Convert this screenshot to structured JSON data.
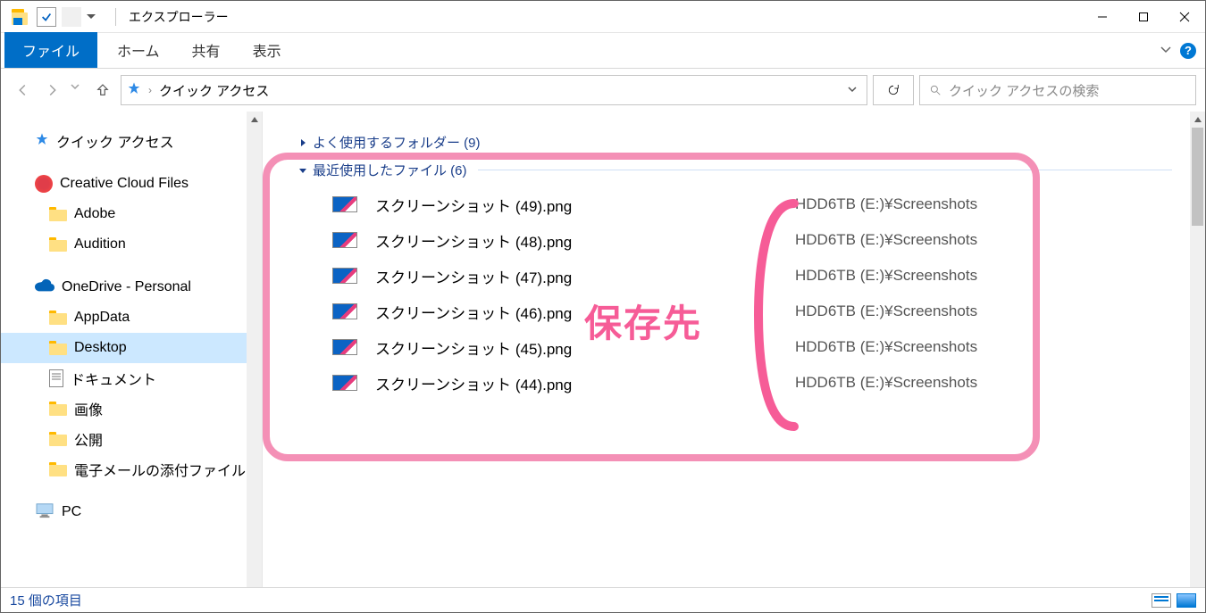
{
  "title": "エクスプローラー",
  "tabs": {
    "file": "ファイル",
    "home": "ホーム",
    "share": "共有",
    "view": "表示"
  },
  "address": {
    "location": "クイック アクセス"
  },
  "search": {
    "placeholder": "クイック アクセスの検索"
  },
  "nav": {
    "qa": "クイック アクセス",
    "cc": "Creative Cloud Files",
    "cc_children": [
      "Adobe",
      "Audition"
    ],
    "od": "OneDrive - Personal",
    "od_children": [
      "AppData",
      "Desktop",
      "ドキュメント",
      "画像",
      "公開",
      "電子メールの添付ファイル"
    ],
    "pc": "PC"
  },
  "groups": {
    "frequent": "よく使用するフォルダー (9)",
    "recent": "最近使用したファイル (6)"
  },
  "files": [
    {
      "name": "スクリーンショット (49).png",
      "loc": "HDD6TB (E:)¥Screenshots"
    },
    {
      "name": "スクリーンショット (48).png",
      "loc": "HDD6TB (E:)¥Screenshots"
    },
    {
      "name": "スクリーンショット (47).png",
      "loc": "HDD6TB (E:)¥Screenshots"
    },
    {
      "name": "スクリーンショット (46).png",
      "loc": "HDD6TB (E:)¥Screenshots"
    },
    {
      "name": "スクリーンショット (45).png",
      "loc": "HDD6TB (E:)¥Screenshots"
    },
    {
      "name": "スクリーンショット (44).png",
      "loc": "HDD6TB (E:)¥Screenshots"
    }
  ],
  "annotation": "保存先",
  "status": "15 個の項目"
}
